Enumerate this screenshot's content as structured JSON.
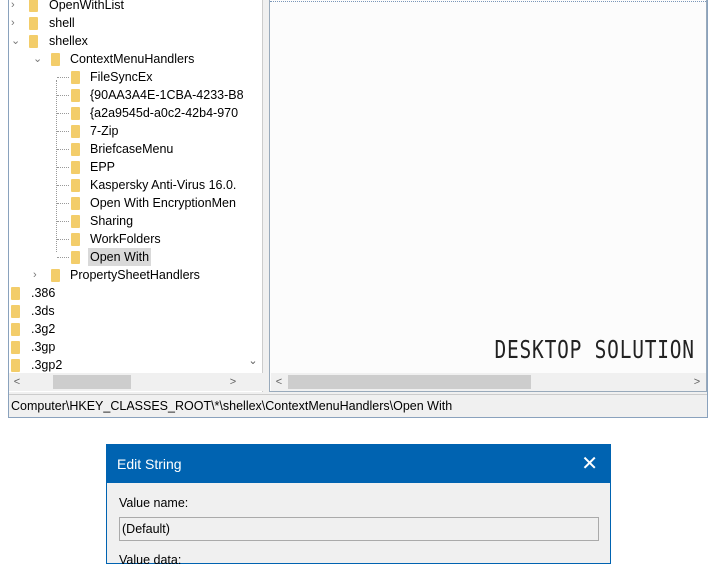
{
  "tree": {
    "items": [
      {
        "label": "OpenWithList",
        "level": 1,
        "chevron": "collapsed"
      },
      {
        "label": "shell",
        "level": 1,
        "chevron": "collapsed"
      },
      {
        "label": "shellex",
        "level": 1,
        "chevron": "expanded"
      },
      {
        "label": "ContextMenuHandlers",
        "level": 2,
        "chevron": "expanded"
      },
      {
        "label": " FileSyncEx",
        "level": 3
      },
      {
        "label": "{90AA3A4E-1CBA-4233-B8",
        "level": 3
      },
      {
        "label": "{a2a9545d-a0c2-42b4-970",
        "level": 3
      },
      {
        "label": "7-Zip",
        "level": 3
      },
      {
        "label": "BriefcaseMenu",
        "level": 3
      },
      {
        "label": "EPP",
        "level": 3
      },
      {
        "label": "Kaspersky Anti-Virus 16.0.",
        "level": 3
      },
      {
        "label": "Open With EncryptionMen",
        "level": 3
      },
      {
        "label": "Sharing",
        "level": 3
      },
      {
        "label": "WorkFolders",
        "level": 3
      },
      {
        "label": "Open With",
        "level": 3,
        "selected": true
      },
      {
        "label": "PropertySheetHandlers",
        "level": 2,
        "chevron": "collapsed"
      },
      {
        "label": ".386",
        "level": 0
      },
      {
        "label": ".3ds",
        "level": 0
      },
      {
        "label": ".3g2",
        "level": 0
      },
      {
        "label": ".3gp",
        "level": 0
      },
      {
        "label": ".3gp2",
        "level": 0
      }
    ]
  },
  "status_path": "Computer\\HKEY_CLASSES_ROOT\\*\\shellex\\ContextMenuHandlers\\Open With",
  "watermark": "DESKTOP SOLUTION",
  "dialog": {
    "title": "Edit String",
    "close": "✕",
    "value_name_label": "Value name:",
    "value_name": "(Default)",
    "value_data_label": "Value data:"
  },
  "colors": {
    "title_bar": "#0063b1",
    "folder": "#f3cd6a"
  }
}
